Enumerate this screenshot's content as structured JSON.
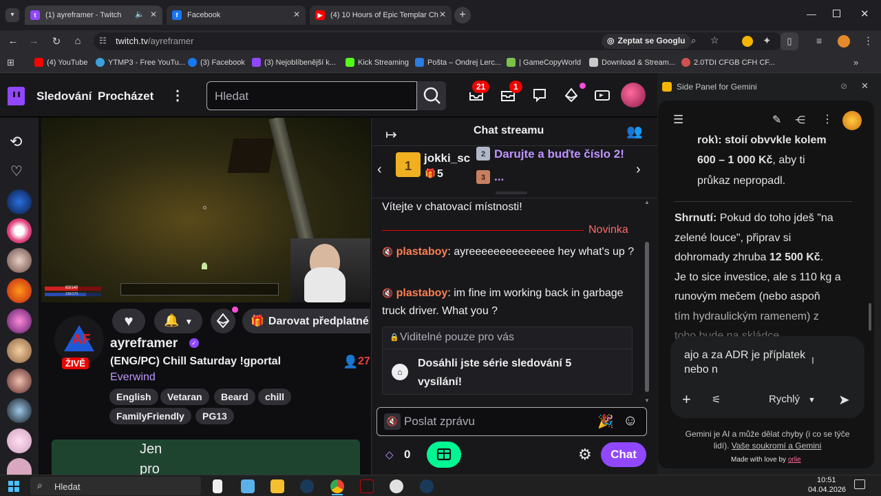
{
  "browser": {
    "tabs": [
      {
        "title": "(1) ayreframer - Twitch",
        "active": true
      },
      {
        "title": "Facebook",
        "active": false
      },
      {
        "title": "(4) 10 Hours of Epic Templar Ch",
        "active": false
      }
    ],
    "url_host": "twitch.tv",
    "url_path": "/ayreframer",
    "ask_google": "Zeptat se Googlu",
    "bookmarks": [
      "(4) YouTube",
      "YTMP3 - Free YouTu...",
      "(3) Facebook",
      "(3) Nejoblíbenější k...",
      "Kick Streaming",
      "Pošta – Ondrej Lerc...",
      "| GameCopyWorld",
      "Download & Stream...",
      "2.0TDI CFGB CFH CF..."
    ]
  },
  "twitch": {
    "nav": {
      "following": "Sledování",
      "browse": "Procházet",
      "search_placeholder": "Hledat"
    },
    "notif_count": "21",
    "inbox_count": "1",
    "channel": {
      "name": "ayreframer",
      "live_label": "ŽIVĚ",
      "title": "(ENG/PC) Chill Saturday !gportal",
      "game": "Everwind",
      "viewers": "27",
      "gift_label": "Darovat předplatné",
      "tags": [
        "English",
        "Vetaran",
        "Beard",
        "chill",
        "FamilyFriendly",
        "PG13"
      ],
      "panel_text_1": "Jen",
      "panel_text_2": "pro"
    },
    "hud": {
      "hp": "83/140",
      "mana": "130/179"
    },
    "chat": {
      "title": "Chat streamu",
      "gifter": "jokki_sc",
      "gift_count": "5",
      "promo": "Darujte a buďte číslo 2!",
      "promo_more": "...",
      "welcome": "Vítejte v chatovací místnosti!",
      "new_label": "Novinka",
      "messages": [
        {
          "user": "plastaboy",
          "text": "ayreeeeeeeeeeeeee hey what's up ?"
        },
        {
          "user": "plastaboy",
          "text": "im fine im working back in garbage truck driver. What you ?"
        }
      ],
      "private_header": "Viditelné pouze pro vás",
      "private_msg": "Dosáhli jste série sledování 5 vysílání!",
      "input_placeholder": "Poslat zprávu",
      "points": "0",
      "chat_button": "Chat"
    }
  },
  "gemini": {
    "panel_title": "Side Panel for Gemini",
    "lines_top": [
      "rok): stojí obvykle kolem",
      "600 – 1 000 Kč",
      ", aby ti",
      "průkaz nepropadl."
    ],
    "summary_label": "Shrnutí:",
    "summary_1": " Pokud do toho jdeš \"na",
    "summary_2": "zelené louce\", připrav si",
    "summary_3a": "dohromady zhruba ",
    "summary_3b": "12 500 Kč",
    "summary_3c": ".",
    "summary_4": "Je to sice investice, ale s 110 kg a",
    "summary_5": "runovým mečem (nebo aspoň",
    "summary_6": "tím hydraulickým ramenem) z",
    "summary_7": "toho bude na skládce...",
    "input_line1": "ajo a za ADR je příplatek",
    "input_line2": "nebo n",
    "mode": "Rychlý",
    "disclaimer_1": "Gemini je AI a může dělat chyby (i co se týče",
    "disclaimer_2a": "lidí). ",
    "disclaimer_2b": "Vaše soukromí a Gemini",
    "made_with": "Made with love by ",
    "made_by": "orlie"
  },
  "taskbar": {
    "search": "Hledat",
    "time": "10:51",
    "date": "04.04.2026"
  },
  "colors": {
    "twitch_purple": "#9147ff",
    "twitch_bg": "#0e0e10",
    "accent_green": "#00f593",
    "live_red": "#eb0400"
  }
}
